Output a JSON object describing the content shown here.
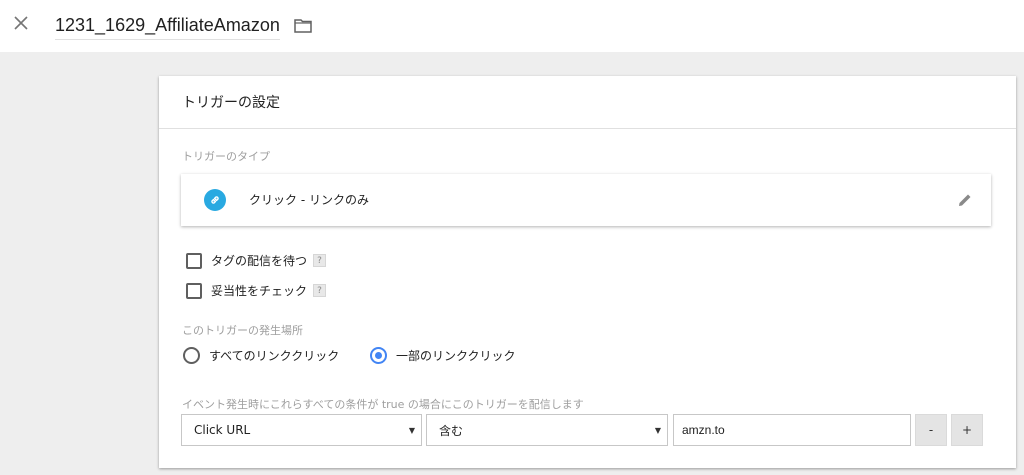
{
  "topbar": {
    "title": "1231_1629_AffiliateAmazon"
  },
  "card": {
    "header": "トリガーの設定",
    "trigger_type_label": "トリガーのタイプ",
    "trigger_type_value": "クリック - リンクのみ",
    "checkboxes": [
      {
        "label": "タグの配信を待つ",
        "help": "?",
        "checked": false
      },
      {
        "label": "妥当性をチェック",
        "help": "?",
        "checked": false
      }
    ],
    "fires_on_label": "このトリガーの発生場所",
    "radios": [
      {
        "label": "すべてのリンククリック",
        "checked": false
      },
      {
        "label": "一部のリンククリック",
        "checked": true
      }
    ],
    "condition_label": "イベント発生時にこれらすべての条件が true の場合にこのトリガーを配信します",
    "condition": {
      "variable": "Click URL",
      "operator": "含む",
      "value": "amzn.to"
    },
    "minus_label": "-",
    "plus_label": "+"
  },
  "colors": {
    "accent_blue": "#4285f4",
    "link_icon_bg": "#29a9e1",
    "page_bg": "#eeeeee"
  },
  "icons": [
    "close-icon",
    "folder-icon",
    "link-icon",
    "pencil-icon",
    "help-icon",
    "dropdown-arrow-icon"
  ]
}
